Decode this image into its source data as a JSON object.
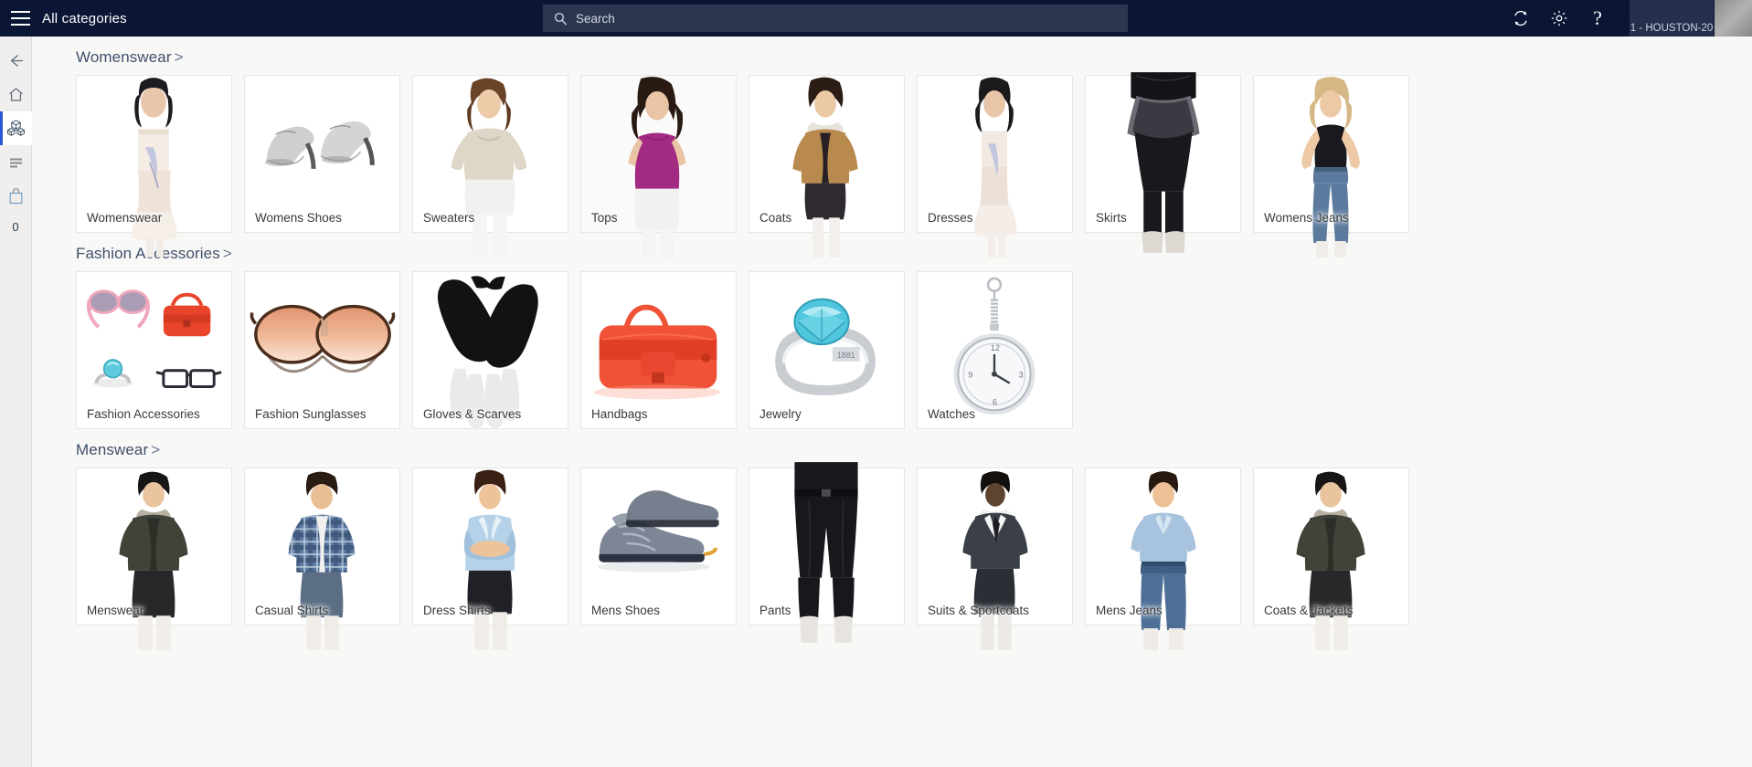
{
  "topbar": {
    "menu_icon": "hamburger-icon",
    "title": "All categories",
    "search": {
      "placeholder": "Search",
      "value": "",
      "icon": "search-icon"
    },
    "icons": [
      {
        "name": "refresh-icon",
        "label": "Refresh"
      },
      {
        "name": "gear-icon",
        "label": "Settings"
      },
      {
        "name": "help-icon",
        "label": "Help"
      }
    ],
    "station": "1 - HOUSTON-20",
    "avatar": "user-avatar",
    "background_color": "#0b1635",
    "search_background_color": "#2c3650"
  },
  "sidebar": {
    "items": [
      {
        "name": "back-button",
        "icon": "arrow-left-icon",
        "active": false
      },
      {
        "name": "home-button",
        "icon": "home-icon",
        "active": false
      },
      {
        "name": "products-button",
        "icon": "products-cubes-icon",
        "active": true
      },
      {
        "name": "list-button",
        "icon": "list-lines-icon",
        "active": false
      },
      {
        "name": "cart-button",
        "icon": "shopping-bag-icon",
        "active": false
      }
    ],
    "cart_count": "0",
    "accent_color": "#2b57d8"
  },
  "main": {
    "sections": [
      {
        "title": "Womenswear",
        "chevron": ">",
        "tiles": [
          {
            "label": "Womenswear",
            "art": "woman-dress"
          },
          {
            "label": "Womens Shoes",
            "art": "heels"
          },
          {
            "label": "Sweaters",
            "art": "woman-sweater"
          },
          {
            "label": "Tops",
            "art": "woman-top"
          },
          {
            "label": "Coats",
            "art": "woman-coat"
          },
          {
            "label": "Dresses",
            "art": "woman-dress2"
          },
          {
            "label": "Skirts",
            "art": "woman-skirt"
          },
          {
            "label": "Womens Jeans",
            "art": "woman-jeans"
          }
        ]
      },
      {
        "title": "Fashion Accessories",
        "chevron": ">",
        "tiles": [
          {
            "label": "Fashion Accessories",
            "art": "accessories-group"
          },
          {
            "label": "Fashion Sunglasses",
            "art": "sunglasses"
          },
          {
            "label": "Gloves & Scarves",
            "art": "gloves"
          },
          {
            "label": "Handbags",
            "art": "handbag"
          },
          {
            "label": "Jewelry",
            "art": "ring"
          },
          {
            "label": "Watches",
            "art": "pocket-watch"
          }
        ]
      },
      {
        "title": "Menswear",
        "chevron": ">",
        "tiles": [
          {
            "label": "Menswear",
            "art": "man-jacket"
          },
          {
            "label": "Casual Shirts",
            "art": "man-plaid"
          },
          {
            "label": "Dress Shirts",
            "art": "man-dressshirt"
          },
          {
            "label": "Mens Shoes",
            "art": "sneakers"
          },
          {
            "label": "Pants",
            "art": "man-pants"
          },
          {
            "label": "Suits & Sportcoats",
            "art": "man-suit"
          },
          {
            "label": "Mens Jeans",
            "art": "man-jeans"
          },
          {
            "label": "Coats & Jackets",
            "art": "man-jacket2"
          }
        ]
      }
    ]
  },
  "colors": {
    "page_background": "#f8f8f7",
    "tile_background": "#ffffff",
    "tile_border": "#e7e6e4",
    "sidebar_background": "#f0efed",
    "header_text": "#41506a",
    "label_text": "#3a3a3a"
  }
}
